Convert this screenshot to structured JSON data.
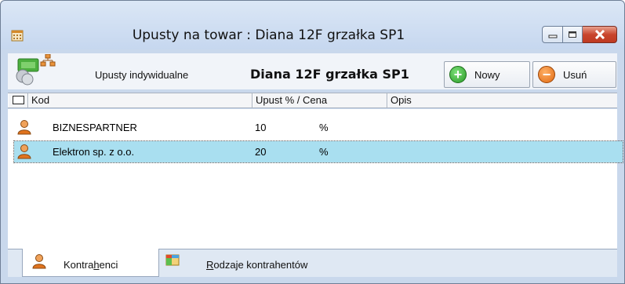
{
  "window": {
    "title": "Upusty na towar : Diana 12F grzałka SP1"
  },
  "toolbar": {
    "section_label": "Upusty indywidualne",
    "product_name": "Diana 12F grzałka SP1",
    "new_label": "Nowy",
    "delete_label": "Usuń"
  },
  "columns": {
    "kod": "Kod",
    "upust": "Upust % / Cena",
    "opis": "Opis"
  },
  "rows": [
    {
      "kod": "BIZNESPARTNER",
      "value": "10",
      "unit": "%",
      "selected": false
    },
    {
      "kod": "Elektron sp. z o.o.",
      "value": "20",
      "unit": "%",
      "selected": true
    }
  ],
  "tabs": {
    "contractors_pre": "Kontra",
    "contractors_u": "h",
    "contractors_post": "enci",
    "types_u": "R",
    "types_post": "odzaje kontrahentów"
  },
  "colors": {
    "window_frame": "#c9d8ec",
    "selection": "#a9dff0",
    "close_button": "#c9452d"
  }
}
